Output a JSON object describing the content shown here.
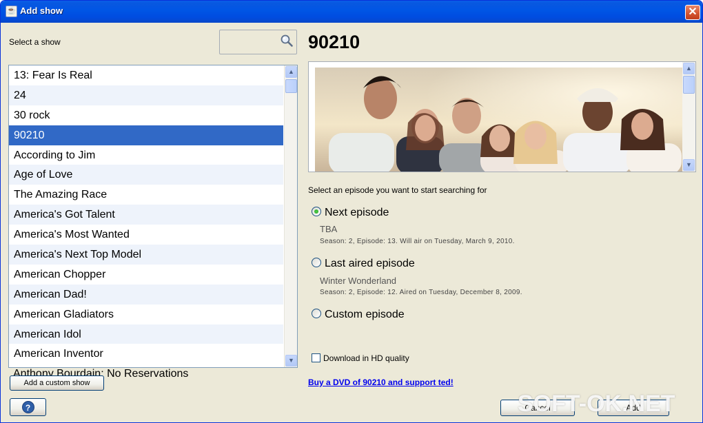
{
  "window": {
    "title": "Add show",
    "close_label": "✕"
  },
  "left": {
    "select_label": "Select a show",
    "search": {
      "value": "",
      "placeholder": ""
    },
    "shows": [
      "13: Fear Is Real",
      "24",
      "30 rock",
      "90210",
      "According to Jim",
      "Age of Love",
      "The Amazing Race",
      "America's Got Talent",
      "America's Most Wanted",
      "America's Next Top Model",
      "American Chopper",
      "American Dad!",
      "American Gladiators",
      "American Idol",
      "American Inventor"
    ],
    "selected_index": 3,
    "overflow_item": "Anthony Bourdain: No Reservations",
    "add_custom_label": "Add a custom show",
    "help_label": "?"
  },
  "right": {
    "show_title": "90210",
    "episode_prompt": "Select an episode you want to start searching for",
    "options": [
      {
        "label": "Next episode",
        "checked": true,
        "name": "TBA",
        "detail": "Season: 2, Episode: 13. Will air on Tuesday, March 9, 2010."
      },
      {
        "label": "Last aired episode",
        "checked": false,
        "name": "Winter Wonderland",
        "detail": "Season: 2, Episode: 12. Aired on Tuesday, December 8, 2009."
      },
      {
        "label": "Custom episode",
        "checked": false
      }
    ],
    "hd_label": "Download in HD quality",
    "dvd_link": "Buy a DVD of 90210 and support ted!",
    "cancel_label": "Cancel",
    "add_label": "Add"
  },
  "watermark": "SOFT-OK.NET",
  "colors": {
    "selection": "#3169c6",
    "titlebar": "#0055e5",
    "link": "#0000ee"
  }
}
